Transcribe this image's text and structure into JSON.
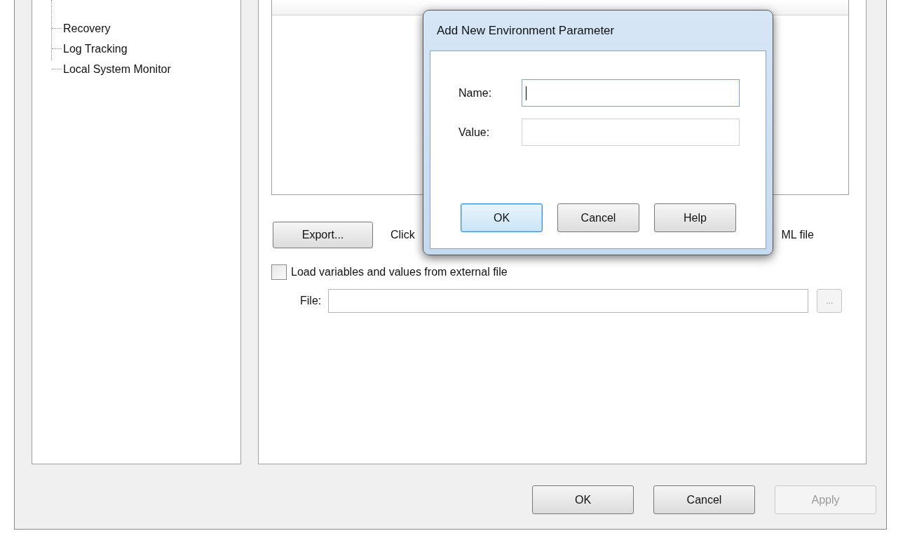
{
  "tree": {
    "items": [
      {
        "label": "Recovery"
      },
      {
        "label": "Log Tracking"
      },
      {
        "label": "Local System Monitor"
      }
    ]
  },
  "export_button": {
    "label": "Export..."
  },
  "export_hint_start": "Click",
  "export_hint_end": "ML file",
  "load_checkbox": {
    "label": "Load variables and values from external file",
    "checked": false
  },
  "file_field": {
    "label": "File:",
    "browse_button": "..."
  },
  "buttons": [
    {
      "label": "OK",
      "disabled": false
    },
    {
      "label": "Cancel",
      "disabled": false
    },
    {
      "label": "Apply",
      "disabled": true
    }
  ],
  "dialog": {
    "title": "Add New Environment Parameter",
    "fields": [
      {
        "label": "Name:",
        "focused": true
      },
      {
        "label": "Value:",
        "focused": false
      }
    ],
    "buttons": [
      {
        "label": "OK",
        "default": true
      },
      {
        "label": "Cancel",
        "default": false
      },
      {
        "label": "Help",
        "default": false
      }
    ]
  }
}
